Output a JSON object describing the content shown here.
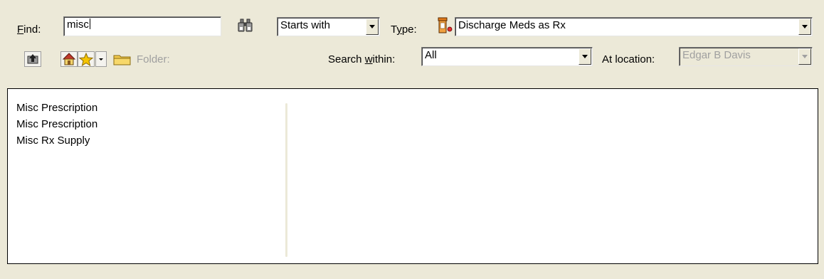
{
  "find": {
    "label_accel": "F",
    "label_rest": "ind:",
    "value": "misc"
  },
  "match_mode": {
    "value": "Starts with"
  },
  "type": {
    "label_pre": "T",
    "label_accel": "y",
    "label_rest": "pe:",
    "value": "Discharge Meds as Rx"
  },
  "folder": {
    "label": "Folder:"
  },
  "search_within": {
    "label_pre": "Search ",
    "label_accel": "w",
    "label_rest": "ithin:",
    "value": "All"
  },
  "at_location": {
    "label": "At location:",
    "value": "Edgar B Davis"
  },
  "results": [
    {
      "label": "Misc Prescription"
    },
    {
      "label": "Misc Prescription"
    },
    {
      "label": "Misc Rx Supply"
    }
  ],
  "colors": {
    "background": "#ece9d8",
    "folder_icon": "#f2c94c",
    "home_icon": "#e8b64a",
    "star_icon": "#f5c400",
    "rx_bottle": "#e07a1a",
    "disabled_text": "#a0a0a0"
  },
  "icons": {
    "binoculars": "binoculars-icon",
    "rx_bottle": "rx-bottle-icon",
    "up_folder": "up-folder-icon",
    "home": "home-icon",
    "favorites": "star-icon",
    "folder": "folder-icon"
  }
}
